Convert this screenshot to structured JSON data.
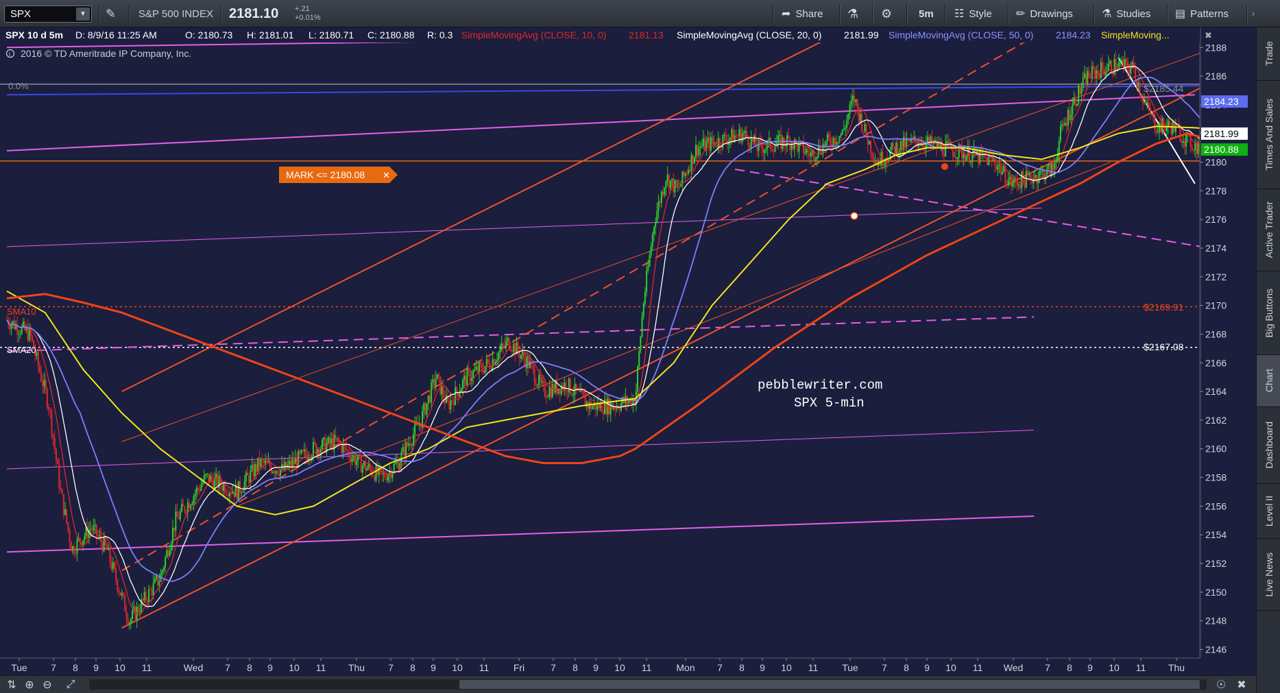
{
  "toolbar": {
    "symbol": "SPX",
    "index_name": "S&P 500 INDEX",
    "last_price": "2181.10",
    "change": "+.21",
    "change_pct": "+0.01%",
    "share": "Share",
    "timeframe": "5m",
    "style": "Style",
    "drawings": "Drawings",
    "studies": "Studies",
    "patterns": "Patterns"
  },
  "header": {
    "symbol_period": "SPX 10 d 5m",
    "date": "D: 8/9/16 11:25 AM",
    "open": "O: 2180.73",
    "high": "H: 2181.01",
    "low": "L: 2180.71",
    "close": "C: 2180.88",
    "range": "R: 0.3",
    "sma10_label": "SimpleMovingAvg (CLOSE, 10, 0)",
    "sma10_value": "2181.13",
    "sma20_label": "SimpleMovingAvg (CLOSE, 20, 0)",
    "sma20_value": "2181.99",
    "sma50_label": "SimpleMovingAvg (CLOSE, 50, 0)",
    "sma50_value": "2184.23",
    "sma_more": "SimpleMoving...",
    "copyright": "2016 © TD Ameritrade IP Company, Inc."
  },
  "annotations": {
    "fib_zero": "0.0%",
    "level_top": "$2185.44",
    "level_mid": "$2169.91",
    "level_low": "$2167.08",
    "sma10_tag": "SMA10",
    "sma20_tag": "SMA20",
    "mark_label": "MARK <= 2180.08",
    "watermark_site": "pebblewriter.com",
    "watermark_desc": "SPX 5-min"
  },
  "price_tags": [
    {
      "value": 2184.23,
      "text": "2184.23",
      "bg": "#5c6cf0",
      "fg": "#ffffff"
    },
    {
      "value": 2181.99,
      "text": "2181.99",
      "bg": "#ffffff",
      "fg": "#000000"
    },
    {
      "value": 2180.88,
      "text": "2180.88",
      "bg": "#10b010",
      "fg": "#ffffff"
    }
  ],
  "colors": {
    "bg": "#1b1e3d",
    "candle_up": "#2bd12b",
    "candle_down": "#e0272d",
    "sma10": "#e0272d",
    "sma20": "#ffffff",
    "sma50": "#7b80ff",
    "sma_yellow": "#f2e61f",
    "sma_orange": "#f04418",
    "trend_orange": "#f0502a",
    "pink": "#e55fe8",
    "blue_line": "#3a47e8",
    "mark": "#e86a10"
  },
  "chart_data": {
    "type": "candlestick",
    "title": "SPX 10 d 5m",
    "y_ticks": [
      2146,
      2148,
      2150,
      2152,
      2154,
      2156,
      2158,
      2160,
      2162,
      2164,
      2166,
      2168,
      2170,
      2172,
      2174,
      2176,
      2178,
      2180,
      2182,
      2184,
      2186,
      2188
    ],
    "ylim": [
      2145.4,
      2189.4
    ],
    "x_ticks": [
      "Tue",
      "7",
      "8",
      "9",
      "10",
      "11",
      "Wed",
      "7",
      "8",
      "9",
      "10",
      "11",
      "Thu",
      "7",
      "8",
      "9",
      "10",
      "11",
      "Fri",
      "7",
      "8",
      "9",
      "10",
      "11",
      "Mon",
      "7",
      "8",
      "9",
      "10",
      "11",
      "Tue",
      "7",
      "8",
      "9",
      "10",
      "11",
      "Wed",
      "7",
      "8",
      "9",
      "10",
      "11",
      "Thu"
    ],
    "price_path": [
      [
        0,
        2169
      ],
      [
        0.3,
        2168
      ],
      [
        0.55,
        2163
      ],
      [
        0.7,
        2157
      ],
      [
        0.85,
        2153
      ],
      [
        1.1,
        2154.5
      ],
      [
        1.3,
        2153
      ],
      [
        1.6,
        2148
      ],
      [
        1.8,
        2149.5
      ],
      [
        2.0,
        2151
      ],
      [
        2.2,
        2155
      ],
      [
        2.6,
        2158
      ],
      [
        3.0,
        2157
      ],
      [
        3.3,
        2159
      ],
      [
        3.6,
        2158.5
      ],
      [
        4.0,
        2160
      ],
      [
        4.3,
        2160.5
      ],
      [
        4.6,
        2159
      ],
      [
        4.9,
        2158
      ],
      [
        5.1,
        2159
      ],
      [
        5.2,
        2160
      ],
      [
        5.4,
        2162
      ],
      [
        5.6,
        2165
      ],
      [
        5.75,
        2163
      ],
      [
        6.0,
        2165
      ],
      [
        6.3,
        2166
      ],
      [
        6.55,
        2167.5
      ],
      [
        6.8,
        2166
      ],
      [
        7.0,
        2164
      ],
      [
        7.3,
        2164.5
      ],
      [
        7.6,
        2163
      ],
      [
        7.9,
        2163
      ],
      [
        8.2,
        2163.5
      ],
      [
        8.3,
        2170
      ],
      [
        8.45,
        2176
      ],
      [
        8.6,
        2179
      ],
      [
        8.75,
        2178
      ],
      [
        9.0,
        2181
      ],
      [
        9.3,
        2181.5
      ],
      [
        9.6,
        2182
      ],
      [
        9.8,
        2181
      ],
      [
        10.2,
        2181.5
      ],
      [
        10.5,
        2180.5
      ],
      [
        10.6,
        2181
      ],
      [
        10.9,
        2182
      ],
      [
        11.05,
        2184.5
      ],
      [
        11.2,
        2182
      ],
      [
        11.35,
        2180
      ],
      [
        11.6,
        2181
      ],
      [
        11.9,
        2181.5
      ],
      [
        12.2,
        2181
      ],
      [
        12.6,
        2180.5
      ],
      [
        12.9,
        2180
      ],
      [
        13.1,
        2178.5
      ],
      [
        13.4,
        2179
      ],
      [
        13.65,
        2179.5
      ],
      [
        13.75,
        2182
      ],
      [
        13.9,
        2184
      ],
      [
        14.1,
        2186
      ],
      [
        14.3,
        2186.5
      ],
      [
        14.5,
        2186.8
      ],
      [
        14.7,
        2186.5
      ],
      [
        14.85,
        2184
      ],
      [
        15.0,
        2182.5
      ],
      [
        15.2,
        2182.5
      ],
      [
        15.4,
        2181.5
      ],
      [
        15.55,
        2181
      ],
      [
        15.7,
        2180.9
      ]
    ],
    "series": [
      {
        "name": "SimpleMovingAvg (CLOSE, 10, 0)",
        "lag": 0.08,
        "color": "#e0272d"
      },
      {
        "name": "SimpleMovingAvg (CLOSE, 20, 0)",
        "lag": 0.16,
        "color": "#ffffff"
      },
      {
        "name": "SimpleMovingAvg (CLOSE, 50, 0)",
        "lag": 0.42,
        "color": "#7b80ff"
      }
    ],
    "yellow_sma": [
      [
        0,
        2171
      ],
      [
        0.5,
        2169.5
      ],
      [
        1,
        2165.5
      ],
      [
        1.5,
        2162.5
      ],
      [
        2,
        2160
      ],
      [
        2.5,
        2158
      ],
      [
        3,
        2156
      ],
      [
        3.5,
        2155.4
      ],
      [
        4,
        2156
      ],
      [
        4.5,
        2157.5
      ],
      [
        5,
        2159
      ],
      [
        5.5,
        2160
      ],
      [
        6,
        2161.5
      ],
      [
        6.5,
        2162
      ],
      [
        7,
        2162.5
      ],
      [
        7.5,
        2163
      ],
      [
        8.2,
        2163.5
      ],
      [
        8.7,
        2166
      ],
      [
        9.2,
        2170
      ],
      [
        9.7,
        2173
      ],
      [
        10.2,
        2176
      ],
      [
        10.7,
        2178.5
      ],
      [
        11.2,
        2179.5
      ],
      [
        11.6,
        2180.5
      ],
      [
        12.0,
        2181
      ],
      [
        12.5,
        2181
      ],
      [
        13.0,
        2180.5
      ],
      [
        13.5,
        2180.2
      ],
      [
        14.0,
        2181
      ],
      [
        14.5,
        2182
      ],
      [
        15.0,
        2182.5
      ],
      [
        15.5,
        2182.4
      ],
      [
        15.75,
        2182.3
      ]
    ],
    "orange_sma": [
      [
        0,
        2170.5
      ],
      [
        0.5,
        2170.8
      ],
      [
        1,
        2170.2
      ],
      [
        1.5,
        2169.5
      ],
      [
        2,
        2168.5
      ],
      [
        2.5,
        2167.5
      ],
      [
        3,
        2166.5
      ],
      [
        3.5,
        2165.5
      ],
      [
        4,
        2164.5
      ],
      [
        4.5,
        2163.5
      ],
      [
        5,
        2162.5
      ],
      [
        5.5,
        2161.5
      ],
      [
        6,
        2160.5
      ],
      [
        6.5,
        2159.5
      ],
      [
        7,
        2159
      ],
      [
        7.5,
        2159
      ],
      [
        8,
        2159.5
      ],
      [
        8.2,
        2160
      ],
      [
        9.0,
        2163
      ],
      [
        10,
        2167
      ],
      [
        11,
        2170.5
      ],
      [
        12,
        2173.5
      ],
      [
        13,
        2176
      ],
      [
        14,
        2178.5
      ],
      [
        14.5,
        2180
      ],
      [
        15,
        2181.3
      ],
      [
        15.4,
        2182
      ],
      [
        15.75,
        2181.5
      ]
    ],
    "levels": [
      {
        "value": 2185.44,
        "color": "#8a8f9a",
        "dash": ""
      },
      {
        "value": 2180.08,
        "color": "#e86a10",
        "dash": ""
      },
      {
        "value": 2169.91,
        "color": "#f04418",
        "dash": "3,4"
      },
      {
        "value": 2167.08,
        "color": "#ffffff",
        "dash": "3,4"
      }
    ],
    "trendlines": [
      {
        "x1": 0,
        "y1": 2188,
        "x2": 17.5,
        "y2": 2189.3,
        "color": "#e55fe8",
        "w": 2,
        "dash": ""
      },
      {
        "x1": 0,
        "y1": 2184.7,
        "x2": 17.5,
        "y2": 2185.4,
        "color": "#3a47e8",
        "w": 2,
        "dash": ""
      },
      {
        "x1": 0,
        "y1": 2180.8,
        "x2": 15.5,
        "y2": 2184.7,
        "color": "#e55fe8",
        "w": 2,
        "dash": ""
      },
      {
        "x1": 0,
        "y1": 2174.1,
        "x2": 13.5,
        "y2": 2176.8,
        "color": "#e55fe8",
        "w": 1,
        "dash": ""
      },
      {
        "x1": 0,
        "y1": 2158.6,
        "x2": 13.4,
        "y2": 2161.3,
        "color": "#e55fe8",
        "w": 1,
        "dash": ""
      },
      {
        "x1": 0,
        "y1": 2152.8,
        "x2": 13.4,
        "y2": 2155.3,
        "color": "#e55fe8",
        "w": 2,
        "dash": ""
      },
      {
        "x1": 0,
        "y1": 2166.8,
        "x2": 13.4,
        "y2": 2169.2,
        "color": "#e55fe8",
        "w": 2,
        "dash": "14,8"
      },
      {
        "x1": 9.5,
        "y1": 2179.5,
        "x2": 15.7,
        "y2": 2174.0,
        "color": "#e55fe8",
        "w": 2,
        "dash": "14,8"
      },
      {
        "x1": 1.5,
        "y1": 2147.5,
        "x2": 17.0,
        "y2": 2189.0,
        "color": "#f0502a",
        "w": 2,
        "dash": ""
      },
      {
        "x1": 1.5,
        "y1": 2164.0,
        "x2": 11.0,
        "y2": 2189.4,
        "color": "#f0502a",
        "w": 2,
        "dash": ""
      },
      {
        "x1": 1.5,
        "y1": 2160.5,
        "x2": 16.5,
        "y2": 2189.4,
        "color": "#f0502a",
        "w": 1,
        "dash": ""
      },
      {
        "x1": 1.5,
        "y1": 2151.5,
        "x2": 13.6,
        "y2": 2189.4,
        "color": "#f0502a",
        "w": 2,
        "dash": "14,8"
      },
      {
        "x1": 3,
        "y1": 2156,
        "x2": 14.4,
        "y2": 2180,
        "color": "#f0502a",
        "w": 1,
        "dash": ""
      },
      {
        "x1": 14.5,
        "y1": 2187.3,
        "x2": 15.5,
        "y2": 2178.5,
        "color": "#ffffff",
        "w": 2,
        "dash": ""
      },
      {
        "x1": 15.7,
        "y1": 2180.5,
        "x2": 16.4,
        "y2": 2174.9,
        "color": "#ffffff",
        "w": 2,
        "dash": ""
      }
    ]
  }
}
